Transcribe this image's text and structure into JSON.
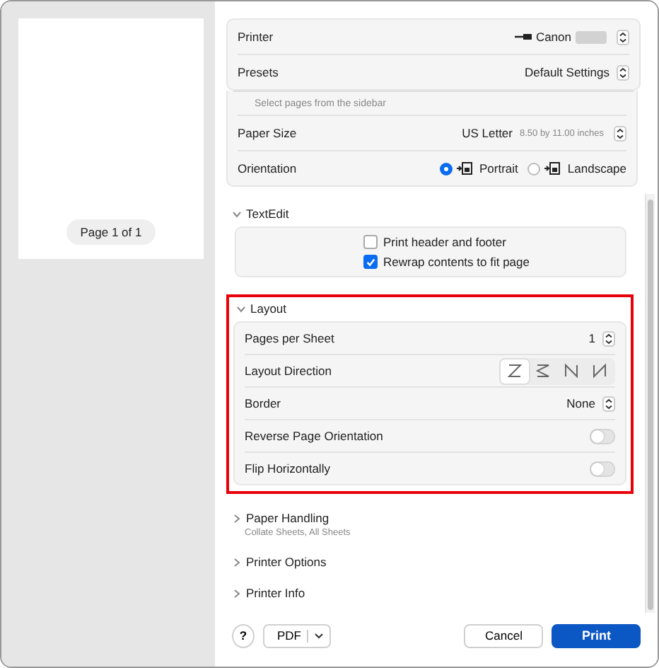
{
  "preview": {
    "page_label": "Page 1 of 1"
  },
  "header": [
    {
      "label": "Printer",
      "value": "Canon",
      "kind": "printer"
    },
    {
      "label": "Presets",
      "value": "Default Settings",
      "kind": "plain"
    }
  ],
  "selection_hint": "Select pages from the sidebar",
  "paper_size": {
    "label": "Paper Size",
    "value": "US Letter",
    "detail": "8.50 by 11.00 inches"
  },
  "orientation": {
    "label": "Orientation",
    "options": [
      {
        "label": "Portrait",
        "selected": true
      },
      {
        "label": "Landscape",
        "selected": false
      }
    ]
  },
  "textedit": {
    "title": "TextEdit",
    "expanded": true,
    "options": [
      {
        "label": "Print header and footer",
        "checked": false
      },
      {
        "label": "Rewrap contents to fit page",
        "checked": true
      }
    ]
  },
  "layout": {
    "title": "Layout",
    "expanded": true,
    "rows": [
      {
        "kind": "select",
        "label": "Pages per Sheet",
        "value": "1"
      },
      {
        "kind": "direction",
        "label": "Layout Direction",
        "options": [
          {
            "selected": true
          },
          {
            "selected": false
          },
          {
            "selected": false
          },
          {
            "selected": false
          }
        ]
      },
      {
        "kind": "select",
        "label": "Border",
        "value": "None"
      },
      {
        "kind": "toggle",
        "label": "Reverse Page Orientation",
        "on": false
      },
      {
        "kind": "toggle",
        "label": "Flip Horizontally",
        "on": false
      }
    ]
  },
  "collapsed_sections": [
    {
      "title": "Paper Handling",
      "subtitle": "Collate Sheets, All Sheets",
      "expanded": false
    },
    {
      "title": "Printer Options",
      "expanded": false
    },
    {
      "title": "Printer Info",
      "expanded": false
    }
  ],
  "footer": {
    "help": "?",
    "pdf": "PDF",
    "cancel": "Cancel",
    "print": "Print"
  }
}
